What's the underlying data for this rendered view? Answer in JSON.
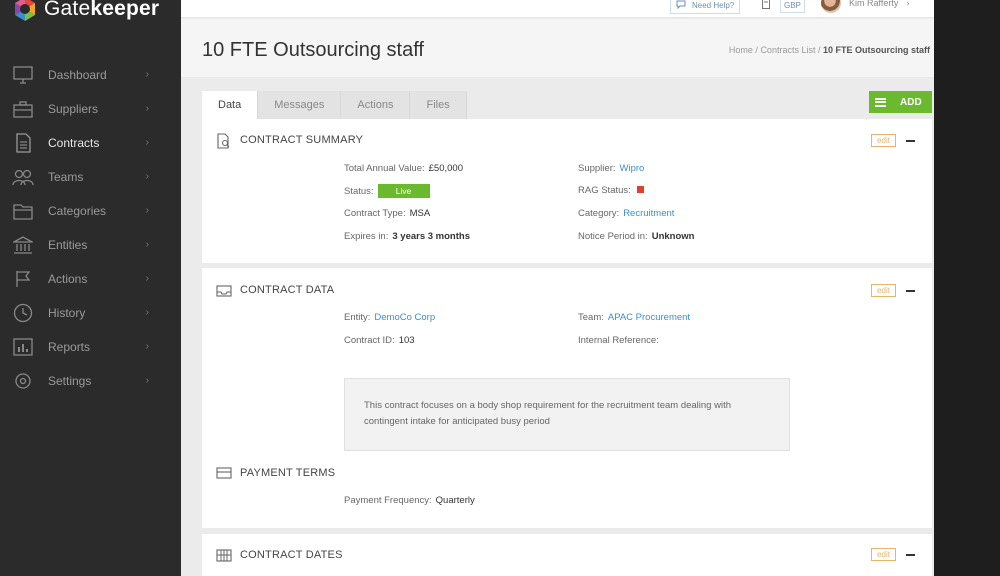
{
  "brand": {
    "name_prefix": "Gate",
    "name_suffix": "keeper",
    "colors": [
      "#e8453c",
      "#f4a623",
      "#7bc043",
      "#3b8fd0",
      "#8e44ad"
    ]
  },
  "sidebar": {
    "items": [
      {
        "label": "Dashboard",
        "icon": "monitor-icon"
      },
      {
        "label": "Suppliers",
        "icon": "briefcase-icon"
      },
      {
        "label": "Contracts",
        "icon": "document-icon"
      },
      {
        "label": "Teams",
        "icon": "people-icon"
      },
      {
        "label": "Categories",
        "icon": "folder-icon"
      },
      {
        "label": "Entities",
        "icon": "building-icon"
      },
      {
        "label": "Actions",
        "icon": "flag-icon"
      },
      {
        "label": "History",
        "icon": "clock-icon"
      },
      {
        "label": "Reports",
        "icon": "bar-chart-icon"
      },
      {
        "label": "Settings",
        "icon": "gear-icon"
      }
    ],
    "active_index": 2
  },
  "topbar": {
    "help_label": "Need Help?",
    "currency_label": "GBP",
    "user_name": "Kim Rafferty"
  },
  "page": {
    "title": "10 FTE Outsourcing staff",
    "breadcrumbs": [
      "Home",
      "Contracts List",
      "10 FTE Outsourcing staff"
    ]
  },
  "tabs": [
    "Data",
    "Messages",
    "Actions",
    "Files"
  ],
  "add_button": "ADD",
  "edit_label": "edit",
  "summary": {
    "title": "CONTRACT SUMMARY",
    "total_label": "Total Annual Value:",
    "total_value": "£50,000",
    "status_label": "Status:",
    "status_value": "Live",
    "type_label": "Contract Type:",
    "type_value": "MSA",
    "expires_label": "Expires in:",
    "expires_value": "3 years 3 months",
    "supplier_label": "Supplier:",
    "supplier_value": "Wipro",
    "rag_label": "RAG Status:",
    "rag_color": "#e0412a",
    "category_label": "Category:",
    "category_value": "Recruitment",
    "notice_label": "Notice Period in:",
    "notice_value": "Unknown"
  },
  "contract_data": {
    "title": "CONTRACT DATA",
    "entity_label": "Entity:",
    "entity_value": "DemoCo Corp",
    "id_label": "Contract ID:",
    "id_value": "103",
    "team_label": "Team:",
    "team_value": "APAC Procurement",
    "ref_label": "Internal Reference:",
    "ref_value": "",
    "note": "This contract focuses on a body shop requirement for the recruitment team dealing with contingent intake for anticipated busy period"
  },
  "payment": {
    "title": "PAYMENT TERMS",
    "freq_label": "Payment Frequency:",
    "freq_value": "Quarterly"
  },
  "dates": {
    "title": "CONTRACT DATES"
  }
}
